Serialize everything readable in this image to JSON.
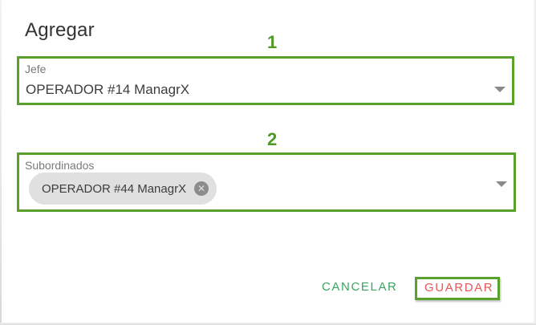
{
  "dialog": {
    "title": "Agregar"
  },
  "annotations": {
    "step_1": "1",
    "step_2": "2"
  },
  "jefe_field": {
    "label": "Jefe",
    "value": "OPERADOR #14 ManagrX"
  },
  "subordinados_field": {
    "label": "Subordinados",
    "chips": [
      {
        "label": "OPERADOR #44 ManagrX"
      }
    ]
  },
  "actions": {
    "cancel_label": "CANCELAR",
    "save_label": "GUARDAR"
  },
  "colors": {
    "annotation_green": "#5aa02c",
    "cancel_text": "#3aa35f",
    "save_text": "#e8585a",
    "chip_background": "#e0e0e0"
  },
  "icons": {
    "dropdown": "chevron-down-icon",
    "chip_delete": "close-circle-icon"
  }
}
